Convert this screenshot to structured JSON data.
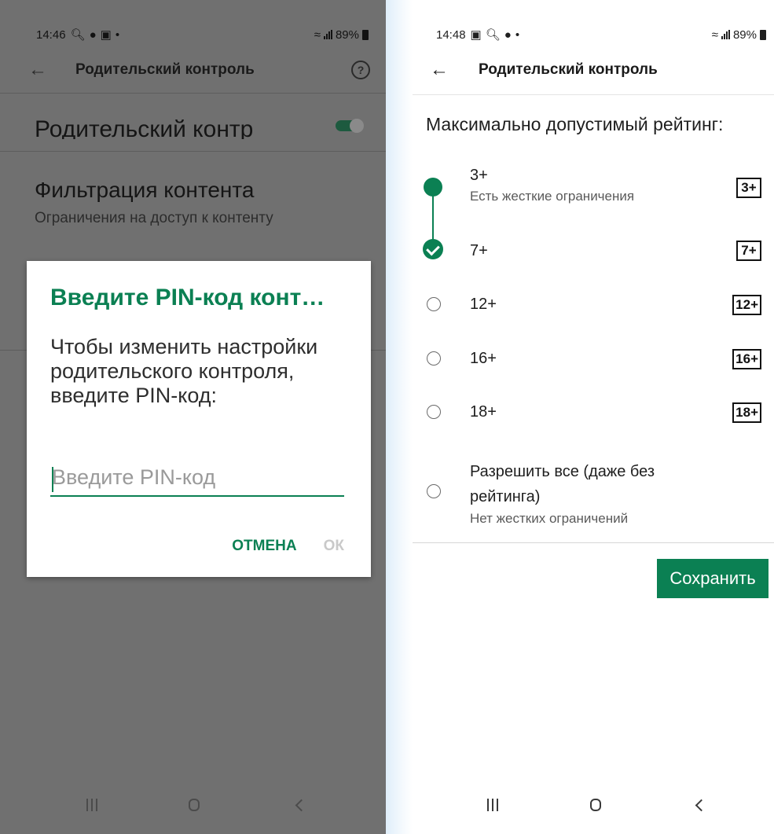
{
  "left_screen": {
    "status": {
      "time": "14:46",
      "battery": "89%"
    },
    "appbar": {
      "title": "Родительский контроль"
    },
    "parental_control": {
      "label": "Родительский контр"
    },
    "content_filtering": {
      "title": "Фильтрация контента",
      "subtitle": "Ограничения на доступ к контенту"
    },
    "dialog": {
      "title": "Введите PIN-код конт…",
      "message": "Чтобы изменить настройки родительского контроля, введите PIN-код:",
      "input_placeholder": "Введите PIN-код",
      "cancel_label": "ОТМЕНА",
      "ok_label": "ОК"
    }
  },
  "right_screen": {
    "status": {
      "time": "14:48",
      "battery": "89%"
    },
    "appbar": {
      "title": "Родительский контроль"
    },
    "max_rating_label": "Максимально допустимый рейтинг:",
    "ratings": [
      {
        "label": "3+",
        "description": "Есть жесткие ограничения",
        "badge": "3+",
        "state": "allowed"
      },
      {
        "label": "7+",
        "badge": "7+",
        "state": "selected"
      },
      {
        "label": "12+",
        "badge": "12+",
        "state": "unselected"
      },
      {
        "label": "16+",
        "badge": "16+",
        "state": "unselected"
      },
      {
        "label": "18+",
        "badge": "18+",
        "state": "unselected"
      },
      {
        "label": "Разрешить все (даже без рейтинга)",
        "description": "Нет жестких ограничений",
        "state": "unselected"
      }
    ],
    "save_label": "Сохранить"
  },
  "colors": {
    "accent": "#0b8053",
    "dim_overlay": "#707070"
  }
}
